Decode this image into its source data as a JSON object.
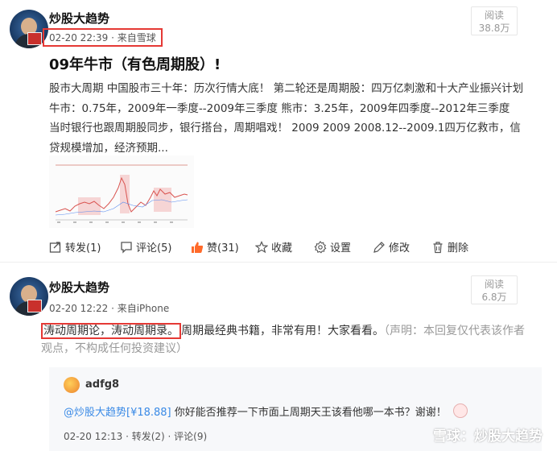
{
  "post1": {
    "username": "炒股大趋势",
    "time_source": "02-20 22:39 · 来自雪球",
    "views_label": "阅读",
    "views_count": "38.8万",
    "title": "09年牛市（有色周期股）!",
    "body": "股市大周期 中国股市三十年：历次行情大底！ 第二轮还是周期股：四万亿刺激和十大产业振兴计划 牛市：0.75年，2009年一季度--2009年三季度 熊市：3.25年，2009年四季度--2012年三季度 当时银行也跟周期股同步，银行搭台，周期唱戏！ 2009 2009 2008.12--2009.1四万亿救市，信贷规模增加，经济预期...",
    "actions": {
      "repost": "转发(1)",
      "comment": "评论(5)",
      "like": "赞(31)",
      "favorite": "收藏",
      "settings": "设置",
      "edit": "修改",
      "delete": "删除"
    }
  },
  "post2": {
    "username": "炒股大趋势",
    "time_source": "02-20 12:22 · 来自iPhone",
    "views_label": "阅读",
    "views_count": "6.8万",
    "highlight": "涛动周期论，涛动周期录。",
    "text": "周期最经典书籍，非常有用！大家看看。",
    "disclaimer": "（声明：本回复仅代表该作者观点，不构成任何投资建议）",
    "quote": {
      "username": "adfg8",
      "mention": "@炒股大趋势[¥18.88]",
      "text": " 你好能否推荐一下市面上周期天王该看他哪一本书？谢谢！",
      "meta": "02-20 12:13 · 转发(2) · 评论(9)"
    }
  },
  "watermark": "雪球：炒股大趋势",
  "colors": {
    "highlight_border": "#e53935",
    "like_icon": "#ff6a2a",
    "mention": "#3a8ae6"
  }
}
